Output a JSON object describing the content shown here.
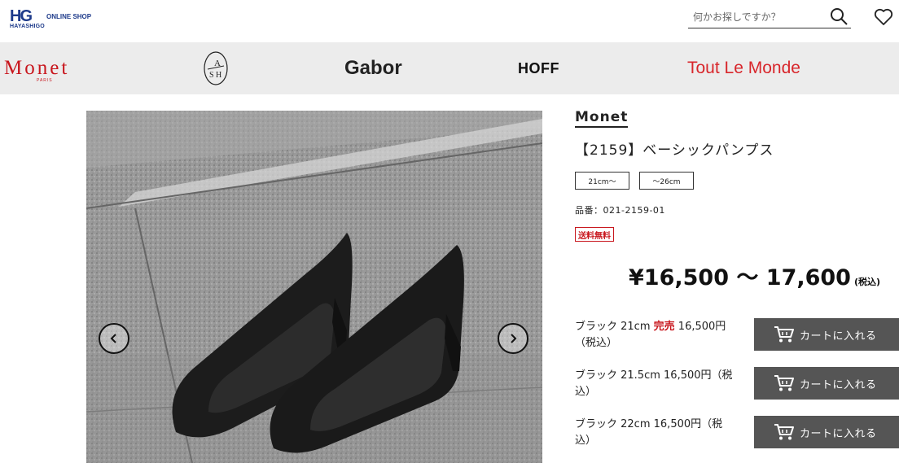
{
  "header": {
    "logo_mark": "HG",
    "logo_sub": "HAYASHIGO",
    "logo_shop": "ONLINE SHOP",
    "search_placeholder": "何かお探しですか？",
    "search_icon": "search-icon",
    "favorite_icon": "heart-icon"
  },
  "brands": {
    "monet": "Monet",
    "monet_sub": "PARIS",
    "ash": "ASH",
    "gabor": "Gabor",
    "hoff": "HOFF",
    "tout_le_monde": "Tout Le Monde"
  },
  "product": {
    "brand": "Monet",
    "title": "【2159】ベーシックパンプス",
    "sizes": [
      "21cm〜",
      "〜26cm"
    ],
    "sku": "品番：021-2159-01",
    "shipping_badge": "送料無料",
    "price": "¥16,500 ～ 17,600",
    "price_tax": "(税込)"
  },
  "variants": [
    {
      "name": "ブラック 21cm",
      "status": "完売",
      "price": "16,500円（税込）",
      "button": "カートに入れる"
    },
    {
      "name": "ブラック 21.5cm",
      "status": "",
      "price": "16,500円（税込）",
      "button": "カートに入れる"
    },
    {
      "name": "ブラック 22cm",
      "status": "",
      "price": "16,500円（税込）",
      "button": "カートに入れる"
    }
  ],
  "colors": {
    "brand_red": "#c8161d",
    "logo_blue": "#1d3a8a",
    "cart_button": "#555555",
    "brand_bar": "#ececec"
  },
  "gallery": {
    "prev_icon": "chevron-left-icon",
    "next_icon": "chevron-right-icon"
  }
}
